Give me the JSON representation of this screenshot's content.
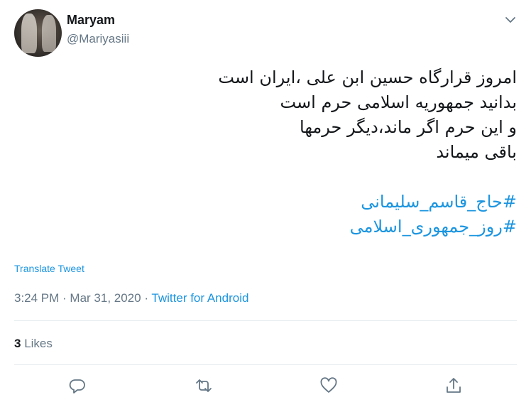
{
  "user": {
    "name": "Maryam",
    "handle": "@Mariyasiii"
  },
  "tweet": {
    "lines": [
      "امروز قرارگاه حسین ابن علی ،ایران است",
      "بدانید جمهوریه اسلامی حرم است",
      "و این حرم اگر ماند،دیگر حرمها",
      "باقی میماند"
    ],
    "hashtags": [
      "#حاج_قاسم_سلیمانی",
      "#روز_جمهوری_اسلامی"
    ]
  },
  "translate_label": "Translate Tweet",
  "meta": {
    "time": "3:24 PM",
    "separator": " · ",
    "date": "Mar 31, 2020",
    "source": "Twitter for Android"
  },
  "likes": {
    "count": "3",
    "label": "Likes"
  },
  "colors": {
    "link": "#1b95e0",
    "secondary": "#657786",
    "text": "#14171a",
    "divider": "#e6ecf0"
  },
  "icons": {
    "more": "chevron-down-icon",
    "reply": "reply-icon",
    "retweet": "retweet-icon",
    "like": "heart-icon",
    "share": "share-icon"
  }
}
